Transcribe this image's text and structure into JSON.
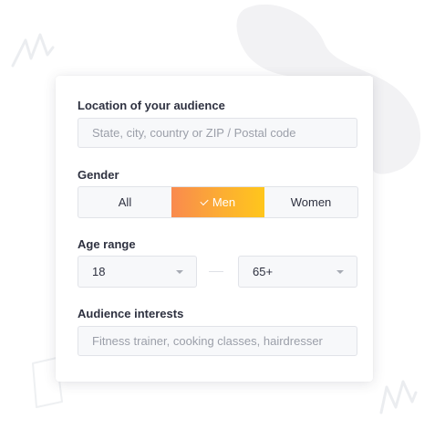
{
  "location": {
    "label": "Location of your audience",
    "placeholder": "State, city, country or ZIP / Postal code"
  },
  "gender": {
    "label": "Gender",
    "options": [
      "All",
      "Men",
      "Women"
    ],
    "selected": "Men"
  },
  "age": {
    "label": "Age range",
    "min": "18",
    "max": "65+"
  },
  "interests": {
    "label": "Audience interests",
    "placeholder": "Fitness trainer, cooking classes, hairdresser"
  },
  "colors": {
    "accent_start": "#f98a4e",
    "accent_end": "#ffc61c",
    "blob": "#f2f2f4"
  }
}
